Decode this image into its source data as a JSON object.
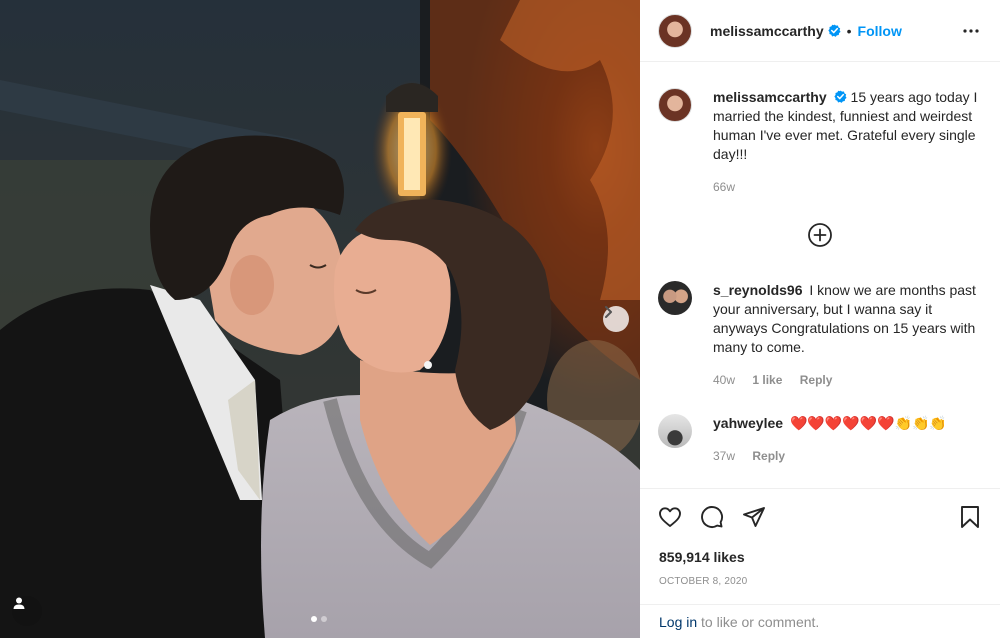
{
  "post": {
    "author": "melissamccarthy",
    "follow_label": "Follow",
    "separator": "•",
    "caption_text": "15 years ago today I married the kindest, funniest and weirdest human I've ever met. Grateful every single day!!!",
    "caption_age": "66w"
  },
  "comments": [
    {
      "user": "s_reynolds96",
      "text": "I know we are months past your anniversary, but I wanna say it anyways Congratulations on 15 years with many to come.",
      "age": "40w",
      "likes": "1 like",
      "reply_label": "Reply"
    },
    {
      "user": "yahweylee",
      "text": "❤️❤️❤️❤️❤️❤️👏👏👏",
      "age": "37w",
      "reply_label": "Reply"
    }
  ],
  "stats": {
    "likes": "859,914 likes",
    "date": "OCTOBER 8, 2020"
  },
  "login": {
    "link": "Log in",
    "rest": "to like or comment."
  },
  "carousel": {
    "count": 2,
    "active": 0
  },
  "icons": [
    "heart-icon",
    "comment-icon",
    "share-icon",
    "bookmark-icon",
    "more-icon",
    "plus-circle-icon",
    "chevron-right-icon",
    "user-tag-icon",
    "verified-icon"
  ],
  "colors": {
    "accent": "#0095f6",
    "link": "#00376b",
    "muted": "#8e8e8e",
    "text": "#262626",
    "heart": "#d7262e",
    "clap": "#f3b71c"
  }
}
